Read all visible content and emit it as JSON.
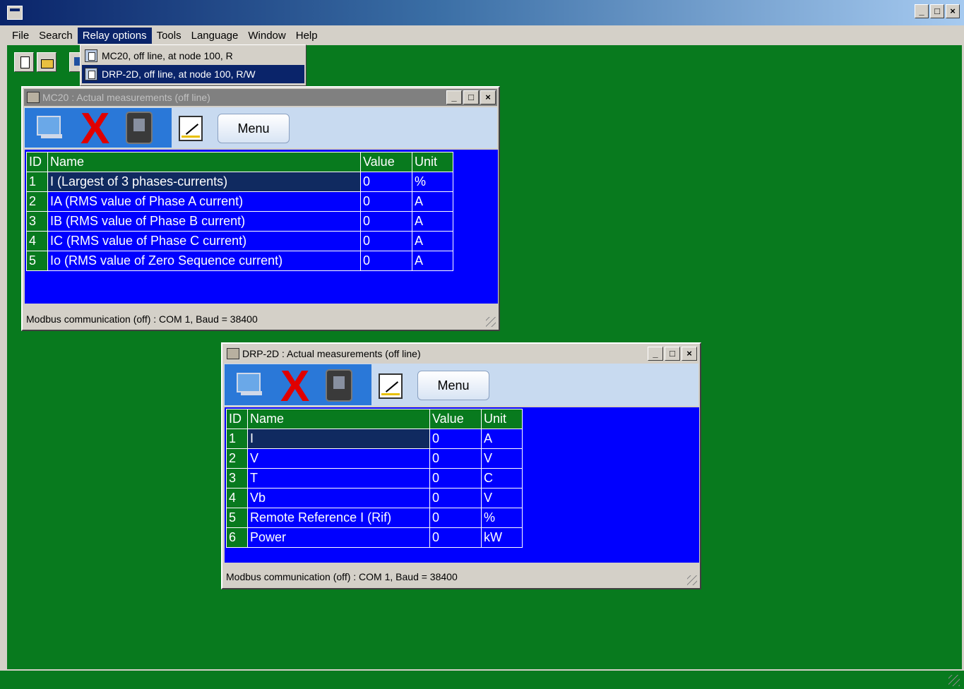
{
  "menu": {
    "items": [
      "File",
      "Search",
      "Relay options",
      "Tools",
      "Language",
      "Window",
      "Help"
    ]
  },
  "titlebar": {
    "min": "_",
    "max": "□",
    "close": "×"
  },
  "dropdown": {
    "items": [
      {
        "label": "MC20, off line, at node 100, R"
      },
      {
        "label": "DRP-2D, off line, at node 100, R/W"
      }
    ]
  },
  "win1": {
    "title": "MC20 : Actual measurements (off line)",
    "menu_label": "Menu",
    "headers": {
      "id": "ID",
      "name": "Name",
      "value": "Value",
      "unit": "Unit"
    },
    "rows": [
      {
        "id": "1",
        "name": "I (Largest of 3 phases-currents)",
        "value": "0",
        "unit": "%"
      },
      {
        "id": "2",
        "name": "IA (RMS value of Phase A current)",
        "value": "0",
        "unit": "A"
      },
      {
        "id": "3",
        "name": "IB (RMS value of Phase B current)",
        "value": "0",
        "unit": "A"
      },
      {
        "id": "4",
        "name": "IC (RMS value of Phase C current)",
        "value": "0",
        "unit": "A"
      },
      {
        "id": "5",
        "name": "Io (RMS value of Zero Sequence current)",
        "value": "0",
        "unit": "A"
      }
    ],
    "status": "Modbus communication (off) : COM 1, Baud = 38400"
  },
  "win2": {
    "title": "DRP-2D : Actual measurements (off line)",
    "menu_label": "Menu",
    "headers": {
      "id": "ID",
      "name": "Name",
      "value": "Value",
      "unit": "Unit"
    },
    "rows": [
      {
        "id": "1",
        "name": "I",
        "value": "0",
        "unit": "A"
      },
      {
        "id": "2",
        "name": "V",
        "value": "0",
        "unit": "V"
      },
      {
        "id": "3",
        "name": "T",
        "value": "0",
        "unit": "C"
      },
      {
        "id": "4",
        "name": " Vb",
        "value": "0",
        "unit": "V"
      },
      {
        "id": "5",
        "name": "Remote Reference I (Rif)",
        "value": "0",
        "unit": " %"
      },
      {
        "id": "6",
        "name": "Power",
        "value": "0",
        "unit": "kW"
      }
    ],
    "status": "Modbus communication (off) : COM 1, Baud = 38400"
  },
  "colors": {
    "workspace": "#087a1e",
    "grid": "#0000ff",
    "titlebar": "#0a246a"
  }
}
